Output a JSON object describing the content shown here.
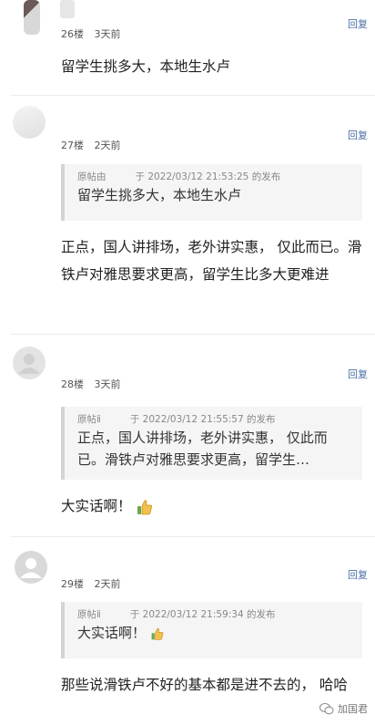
{
  "reply_label": "回复",
  "posts": [
    {
      "floor": "26楼",
      "time": "3天前",
      "content": "留学生挑多大，本地生水卢"
    },
    {
      "floor": "27楼",
      "time": "2天前",
      "quote": {
        "author": "原帖由",
        "posted": "于 2022/03/12 21:53:25 的发布",
        "text": "留学生挑多大，本地生水卢"
      },
      "content": "正点，国人讲排场，老外讲实惠， 仅此而已。滑铁卢对雅思要求更高，留学生比多大更难进"
    },
    {
      "floor": "28楼",
      "time": "3天前",
      "quote": {
        "author": "原帖ⅱ",
        "posted": "于 2022/03/12 21:55:57 的发布",
        "text": "正点，国人讲排场，老外讲实惠， 仅此而已。滑铁卢对雅思要求更高，留学生…"
      },
      "content": "大实话啊！"
    },
    {
      "floor": "29楼",
      "time": "2天前",
      "quote": {
        "author": "原帖ⅱ",
        "posted": "于 2022/03/12 21:59:34 的发布",
        "text": "大实话啊！"
      },
      "content": "那些说滑铁卢不好的基本都是进不去的， 哈哈"
    }
  ],
  "watermark": "加国君",
  "icons": {
    "thumbs_up": "thumbs-up-icon",
    "default_avatar": "default-avatar-icon",
    "watermark_logo": "wechat-logo-icon"
  }
}
